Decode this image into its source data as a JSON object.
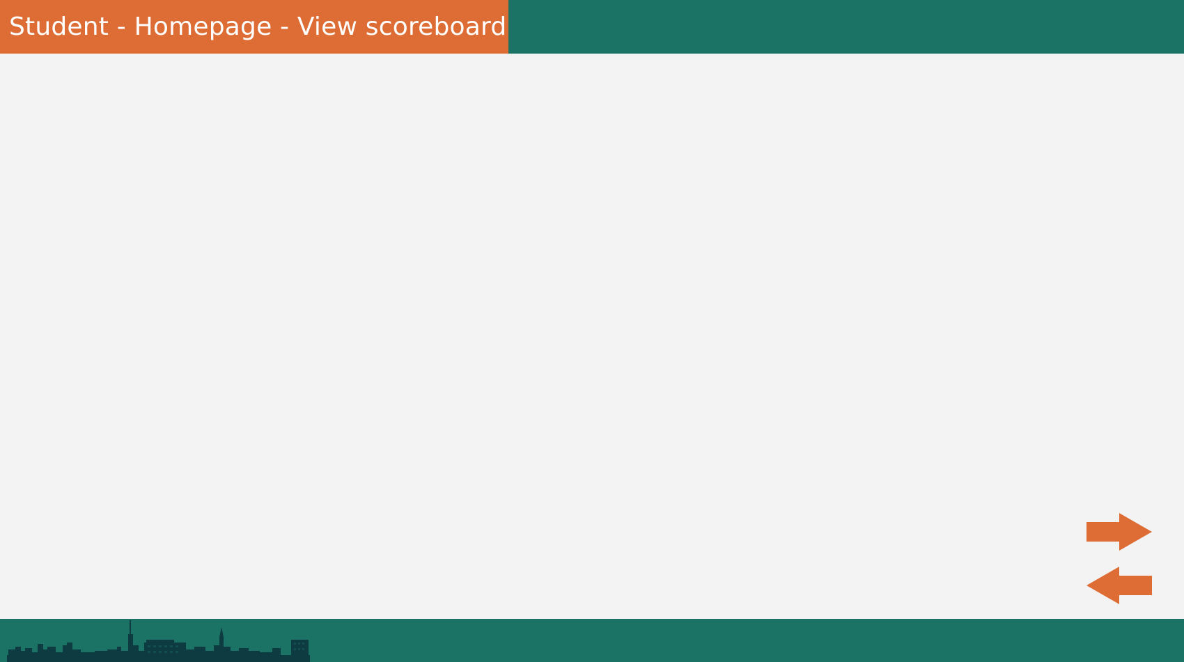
{
  "header": {
    "title": "Student - Homepage - View scoreboard"
  },
  "navigation": {
    "next_icon": "arrow-right-icon",
    "prev_icon": "arrow-left-icon"
  },
  "footer": {
    "decoration": "city-skyline-icon"
  },
  "colors": {
    "accent_orange": "#dd6d35",
    "brand_teal": "#1a7365",
    "background": "#f3f3f3",
    "skyline": "#0e3a42"
  }
}
